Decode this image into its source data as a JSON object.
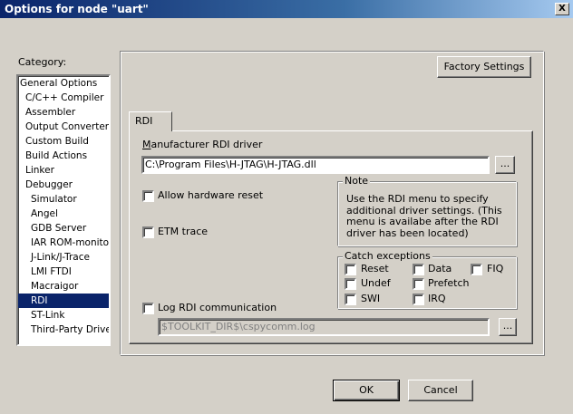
{
  "window": {
    "title": "Options for node \"uart\"",
    "close_label": "X"
  },
  "category": {
    "label": "Category:",
    "items": [
      {
        "label": "General Options"
      },
      {
        "label": "C/C++ Compiler"
      },
      {
        "label": "Assembler"
      },
      {
        "label": "Output Converter"
      },
      {
        "label": "Custom Build"
      },
      {
        "label": "Build Actions"
      },
      {
        "label": "Linker"
      },
      {
        "label": "Debugger"
      },
      {
        "label": "Simulator"
      },
      {
        "label": "Angel"
      },
      {
        "label": "GDB Server"
      },
      {
        "label": "IAR ROM-monitor"
      },
      {
        "label": "J-Link/J-Trace"
      },
      {
        "label": "LMI FTDI"
      },
      {
        "label": "Macraigor"
      },
      {
        "label": "RDI"
      },
      {
        "label": "ST-Link"
      },
      {
        "label": "Third-Party Driver"
      }
    ],
    "selected": "RDI"
  },
  "factory_settings_label": "Factory Settings",
  "tab": {
    "label": "RDI"
  },
  "driver": {
    "label": "Manufacturer RDI driver",
    "value": "C:\\Program Files\\H-JTAG\\H-JTAG.dll",
    "browse_label": "..."
  },
  "allow_reset": {
    "label": "Allow hardware reset",
    "checked": false
  },
  "etm_trace": {
    "label": "ETM trace",
    "checked": false
  },
  "note": {
    "title": "Note",
    "lines": [
      "Use the RDI menu to specify",
      "additional driver settings. (This",
      "menu is availabe after the RDI",
      "driver has been located)"
    ]
  },
  "catch": {
    "title": "Catch exceptions",
    "reset": "Reset",
    "data": "Data",
    "fiq": "FIQ",
    "undef": "Undef",
    "prefetch": "Prefetch",
    "swi": "SWI",
    "irq": "IRQ"
  },
  "log": {
    "label": "Log RDI communication",
    "checked": false,
    "value": "$TOOLKIT_DIR$\\cspycomm.log",
    "browse_label": "..."
  },
  "ok_label": "OK",
  "cancel_label": "Cancel"
}
